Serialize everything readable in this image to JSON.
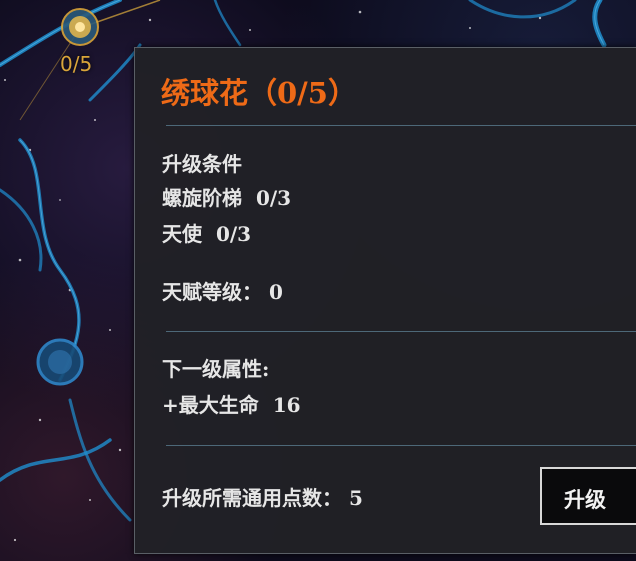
{
  "node": {
    "counter": "0/5"
  },
  "tooltip": {
    "title": "绣球花（0/5）",
    "requirements_header": "升级条件",
    "requirements": [
      {
        "name": "螺旋阶梯",
        "progress": "0/3"
      },
      {
        "name": "天使",
        "progress": "0/3"
      }
    ],
    "talent_level_label": "天赋等级：",
    "talent_level_value": "0",
    "next_level_header": "下一级属性:",
    "next_level_bonus": "+最大生命",
    "next_level_bonus_value": "16",
    "cost_label": "升级所需通用点数：",
    "cost_value": "5",
    "upgrade_button_label": "升级"
  },
  "colors": {
    "title": "#ee6a17",
    "node_text": "#d9a53a",
    "panel_bg": "#212126",
    "divider": "#4d6878",
    "vein_blue": "#1f8fd0"
  }
}
